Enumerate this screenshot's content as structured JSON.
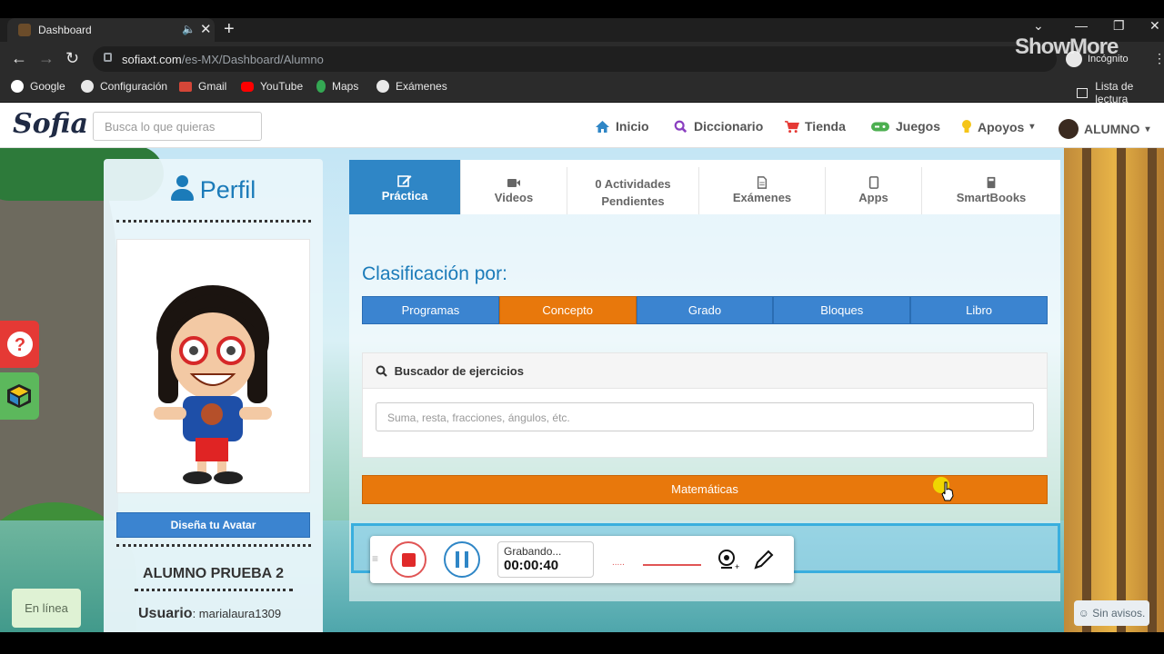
{
  "browser": {
    "tab_title": "Dashboard",
    "new_tab": "+",
    "url_domain": "sofiaxt.com",
    "url_path": "/es-MX/Dashboard/Alumno",
    "incognito": "Incógnito",
    "watermark": "ShowMore",
    "bookmarks": [
      "Google",
      "Configuración",
      "Gmail",
      "YouTube",
      "Maps",
      "Exámenes"
    ],
    "reading_list": "Lista de lectura"
  },
  "site": {
    "logo": "Sofia",
    "search_placeholder": "Busca lo que quieras",
    "nav": [
      "Inicio",
      "Diccionario",
      "Tienda",
      "Juegos",
      "Apoyos",
      "ALUMNO"
    ]
  },
  "profile": {
    "title": "Perfil",
    "avatar_button": "Diseña tu Avatar",
    "name": "ALUMNO PRUEBA 2",
    "user_label": "Usuario",
    "user_value": ": marialaura1309"
  },
  "tabs": [
    {
      "label": "Práctica",
      "icon": "edit-icon",
      "active": true
    },
    {
      "label": "Videos",
      "icon": "video-camera-icon",
      "active": false
    },
    {
      "label_line1": "0 Actividades",
      "label_line2": "Pendientes",
      "active": false
    },
    {
      "label": "Exámenes",
      "icon": "document-icon",
      "active": false
    },
    {
      "label": "Apps",
      "icon": "tablet-icon",
      "active": false
    },
    {
      "label": "SmartBooks",
      "icon": "book-icon",
      "active": false
    }
  ],
  "classification": {
    "title": "Clasificación por:",
    "filters": [
      "Programas",
      "Concepto",
      "Grado",
      "Bloques",
      "Libro"
    ],
    "active_filter": "Concepto"
  },
  "finder": {
    "title": "Buscador de ejercicios",
    "placeholder": "Suma, resta, fracciones, ángulos, étc."
  },
  "subject_button": "Matemáticas",
  "status": {
    "online": "En línea",
    "notices": "Sin avisos."
  },
  "recorder": {
    "state": "Grabando...",
    "time": "00:00:40"
  },
  "colors": {
    "primary_blue": "#3b84d0",
    "active_orange": "#e8780c",
    "title_blue": "#1b7bb9"
  }
}
